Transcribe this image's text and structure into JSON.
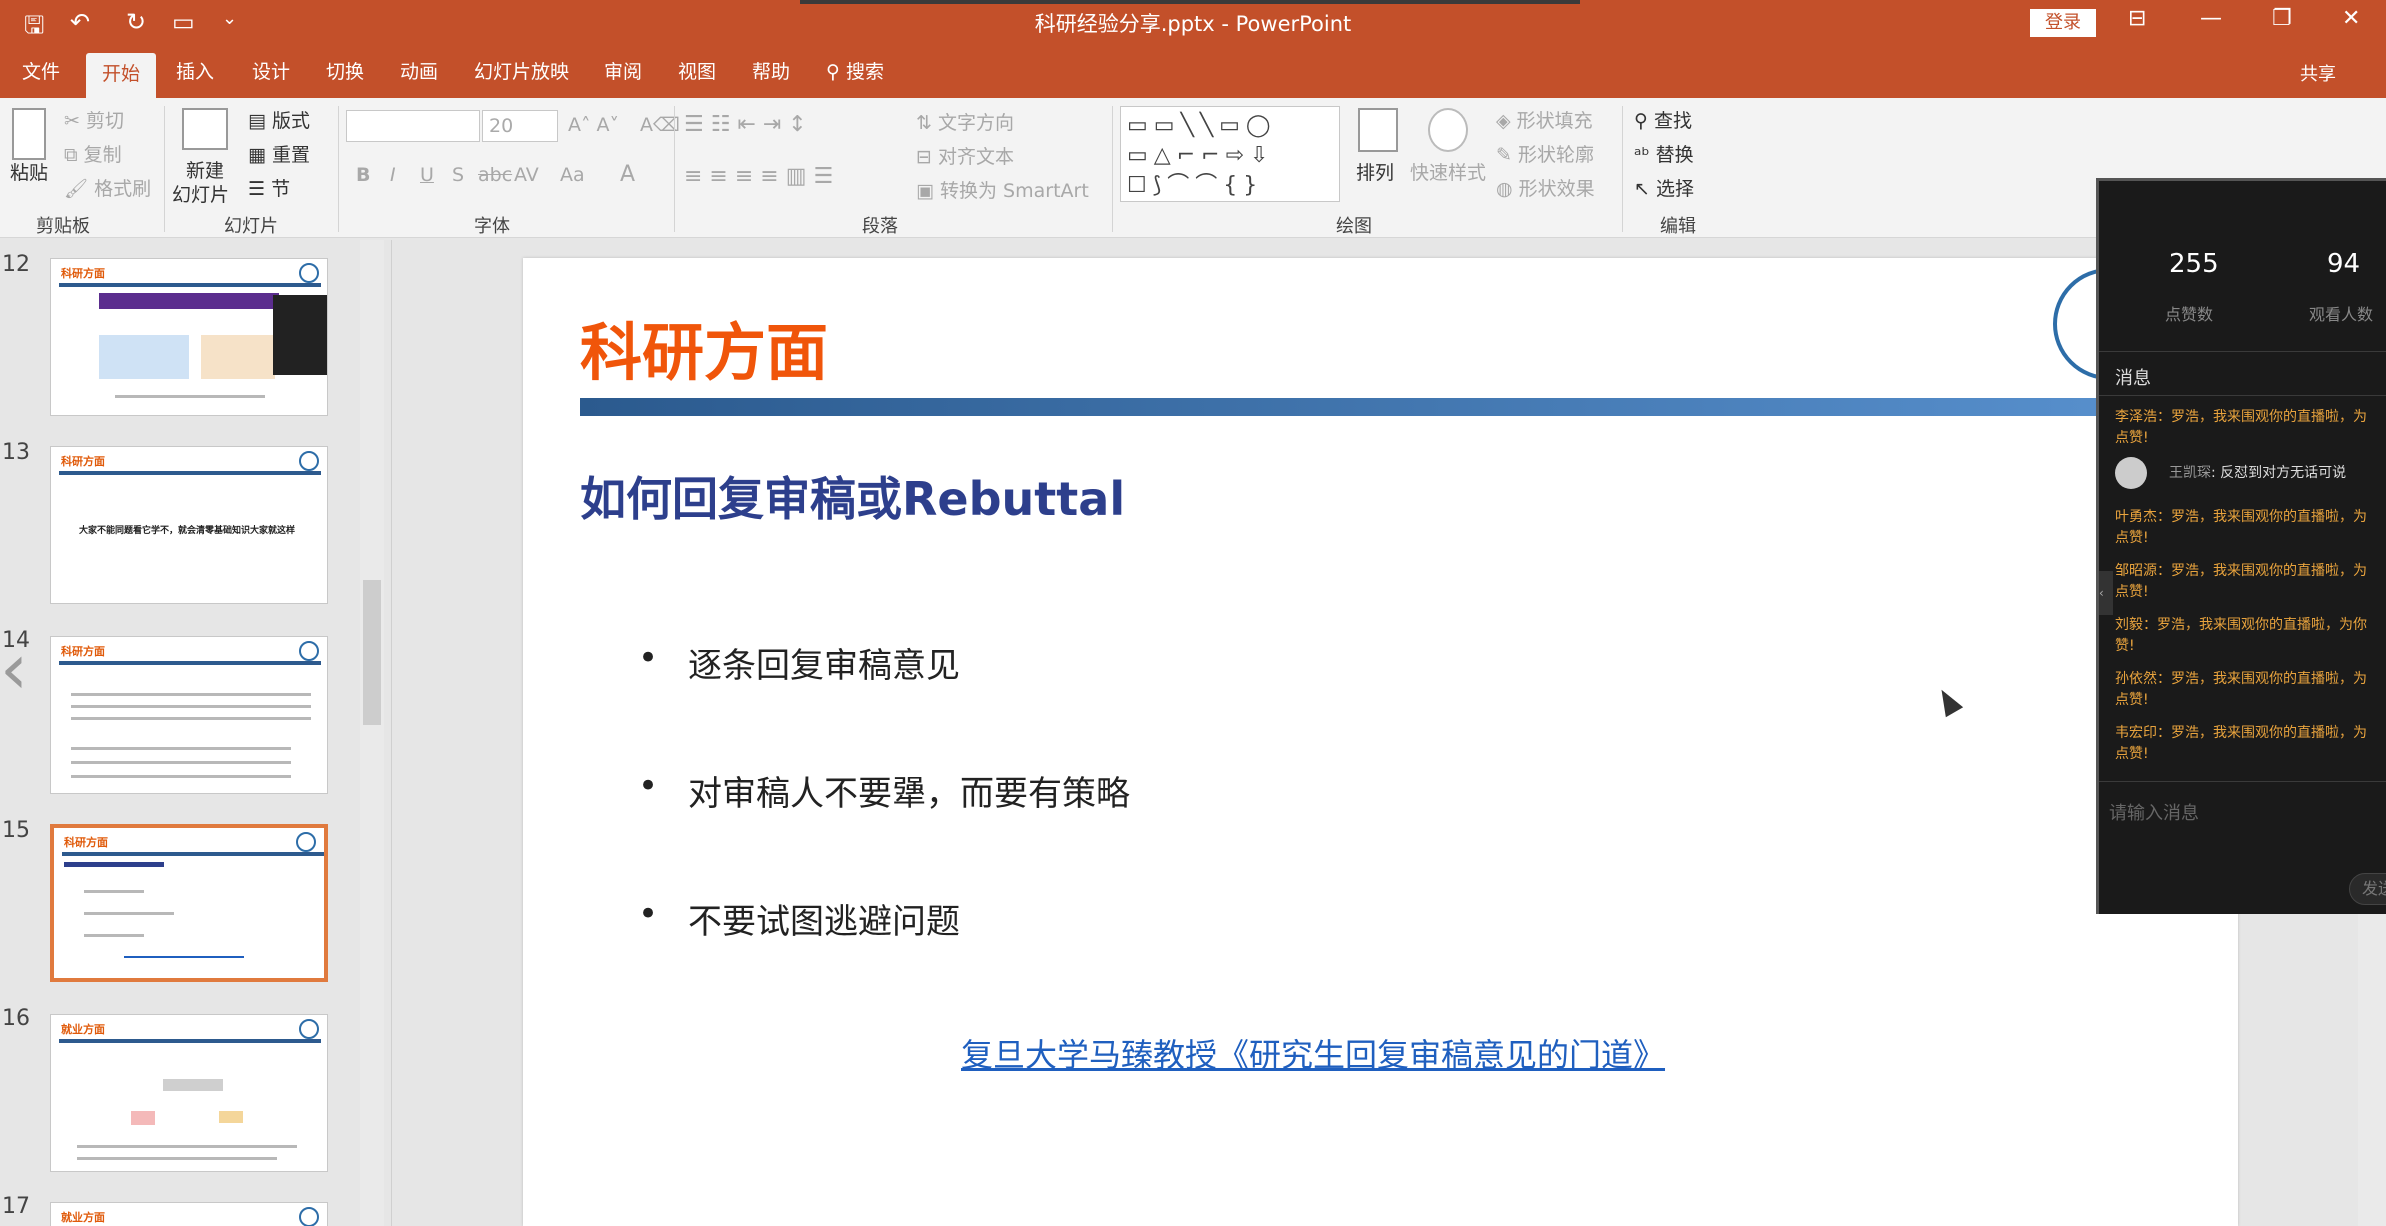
{
  "titlebar": {
    "qa_save": "🖫",
    "qa_undo": "↶",
    "qa_redo": "↻",
    "qa_present": "▭",
    "qa_more": "⌄",
    "title": "科研经验分享.pptx - PowerPoint",
    "login_label": "登录",
    "restore_ribbon": "⊟",
    "minimize": "—",
    "maximize": "❐",
    "close": "✕"
  },
  "tabs": [
    "文件",
    "开始",
    "插入",
    "设计",
    "切换",
    "动画",
    "幻灯片放映",
    "审阅",
    "视图",
    "帮助"
  ],
  "search": {
    "icon": "⚲",
    "label": "搜索"
  },
  "share_label": "共享",
  "ribbon": {
    "clipboard": {
      "paste": "粘贴",
      "cut": "剪切",
      "copy": "复制",
      "format_painter": "格式刷",
      "group": "剪贴板"
    },
    "slides": {
      "new_slide_1": "新建",
      "new_slide_2": "幻灯片",
      "layout": "版式",
      "reset": "重置",
      "section": "节",
      "group": "幻灯片"
    },
    "font": {
      "size": "20",
      "bold": "B",
      "italic": "I",
      "underline": "U",
      "strike": "S",
      "shadow": "abc",
      "spacing": "AV",
      "case": "Aa",
      "color": "A",
      "group": "字体"
    },
    "paragraph": {
      "text_direction": "文字方向",
      "align_text": "对齐文本",
      "smartart": "转换为 SmartArt",
      "group": "段落"
    },
    "drawing": {
      "arrange": "排列",
      "quick_styles": "快速样式",
      "shape_fill": "形状填充",
      "shape_outline": "形状轮廓",
      "shape_effects": "形状效果",
      "group": "绘图"
    },
    "editing": {
      "find": "查找",
      "replace": "替换",
      "select": "选择",
      "group": "编辑"
    }
  },
  "thumbnails": [
    {
      "num": "12",
      "title": "科研方面"
    },
    {
      "num": "13",
      "title": "科研方面"
    },
    {
      "num": "14",
      "title": "科研方面"
    },
    {
      "num": "15",
      "title": "科研方面"
    },
    {
      "num": "16",
      "title": "就业方面"
    },
    {
      "num": "17",
      "title": "就业方面"
    }
  ],
  "slide": {
    "title": "科研方面",
    "subtitle": "如何回复审稿或Rebuttal",
    "bullets": [
      "逐条回复审稿意见",
      "对审稿人不要犟，而要有策略",
      "不要试图逃避问题"
    ],
    "link": "复旦大学马臻教授《研究生回复审稿意见的门道》"
  },
  "chat": {
    "likes": "255",
    "likes_label": "点赞数",
    "viewers": "94",
    "viewers_label": "观看人数",
    "messages_header": "消息",
    "messages": [
      {
        "l1": "李泽浩：罗浩，我来围观你的直播啦，为",
        "l2": "点赞!"
      },
      {
        "name": "王凯琛",
        "text": "反怼到对方无话可说"
      },
      {
        "l1": "叶勇杰：罗浩，我来围观你的直播啦，为",
        "l2": "点赞!"
      },
      {
        "l1": "邹昭源：罗浩，我来围观你的直播啦，为",
        "l2": "点赞!"
      },
      {
        "l1": "刘毅：罗浩，我来围观你的直播啦，为你",
        "l2": "赞!"
      },
      {
        "l1": "孙依然：罗浩，我来围观你的直播啦，为",
        "l2": "点赞!"
      },
      {
        "l1": "韦宏印：罗浩，我来围观你的直播啦，为",
        "l2": "点赞!"
      }
    ],
    "input_placeholder": "请输入消息",
    "send": "发送"
  },
  "thumb13_text": "大家不能同题看它学不，就会清零基础知识大家就这样"
}
